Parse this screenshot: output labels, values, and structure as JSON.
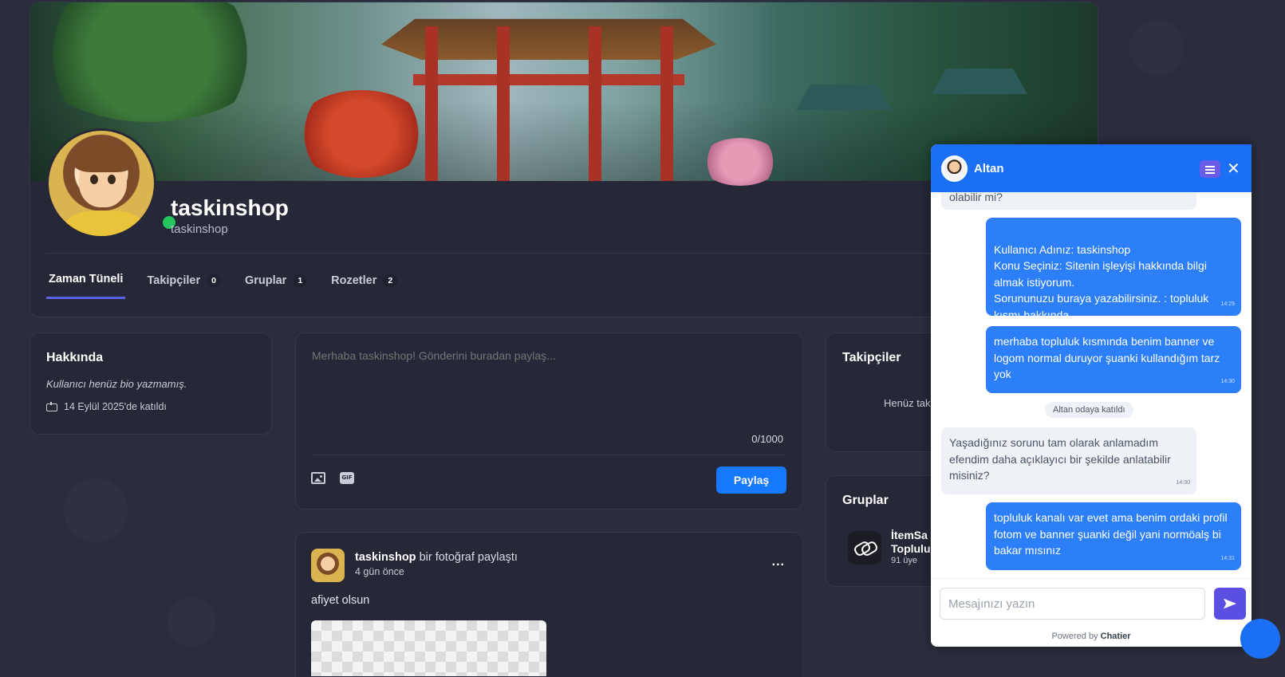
{
  "profile": {
    "name": "taskinshop",
    "handle": "taskinshop",
    "online": true,
    "tabs": [
      {
        "label": "Zaman Tüneli",
        "count": null,
        "active": true
      },
      {
        "label": "Takipçiler",
        "count": "0"
      },
      {
        "label": "Gruplar",
        "count": "1"
      },
      {
        "label": "Rozetler",
        "count": "2"
      }
    ]
  },
  "about": {
    "title": "Hakkında",
    "bio": "Kullanıcı henüz bio yazmamış.",
    "joined": "14 Eylül 2025'de katıldı",
    "joined_icon": "cake-icon"
  },
  "composer": {
    "placeholder": "Merhaba taskinshop! Gönderini buradan paylaş...",
    "counter": "0/1000",
    "share_label": "Paylaş",
    "share_color": "#1677ff"
  },
  "post": {
    "author": "taskinshop",
    "action": " bir fotoğraf paylaştı",
    "time": "4 gün önce",
    "more": "...",
    "text": "afiyet olsun"
  },
  "followers": {
    "title": "Takipçiler",
    "empty_text": "Henüz tak"
  },
  "groups": {
    "title": "Gruplar",
    "items": [
      {
        "name_line1": "İtemSa",
        "name_line2": "Toplulu",
        "members": "91 üye",
        "icon": "link-icon"
      }
    ]
  },
  "chat": {
    "agent_name": "Altan",
    "header_color": "#1a6ff5",
    "messages": [
      {
        "dir": "in",
        "text": "olabilir mi?",
        "time": ""
      },
      {
        "dir": "out",
        "text": "Kullanıcı Adınız: taskinshop\nKonu Seçiniz: Sitenin işleyişi hakkında bilgi almak istiyorum.\nSorununuzu buraya yazabilirsiniz. : topluluk kısmı hakkında",
        "time": "14:29"
      },
      {
        "dir": "out",
        "text": "merhaba topluluk kısmında benim banner ve logom normal duruyor şuanki kullandığım tarz yok",
        "time": "14:30"
      },
      {
        "dir": "system",
        "text": "Altan odaya katıldı"
      },
      {
        "dir": "in",
        "text": "Yaşadığınız sorunu tam olarak anlamadım efendim daha açıklayıcı bir şekilde anlatabilir misiniz?",
        "time": "14:30"
      },
      {
        "dir": "out",
        "text": "topluluk kanalı var evet ama benim ordaki profil fotom ve banner şuanki değil yani normöalş bi bakar mısınız",
        "time": "14:31"
      }
    ],
    "input_placeholder": "Mesajınızı yazın",
    "powered_prefix": "Powered by",
    "powered_brand": "Chatier"
  }
}
